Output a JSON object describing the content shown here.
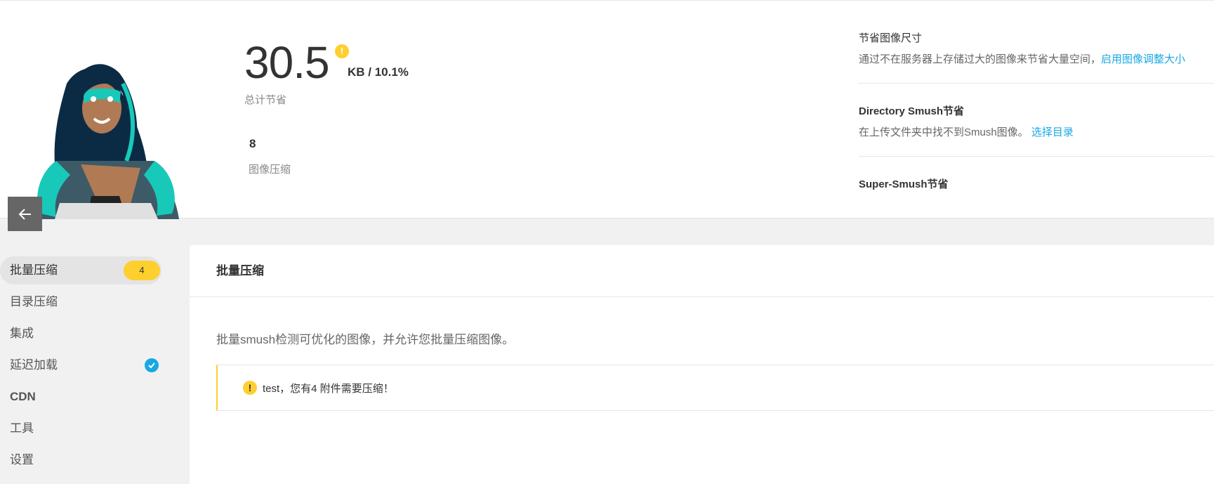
{
  "summary": {
    "total_savings_value": "30.5",
    "total_savings_unit": "KB / 10.1%",
    "total_savings_label": "总计节省",
    "images_count": "8",
    "images_label": "图像压缩",
    "resize": {
      "title": "节省图像尺寸",
      "desc": "通过不在服务器上存储过大的图像来节省大量空间，",
      "link": "启用图像调整大小"
    },
    "directory": {
      "title": "Directory Smush节省",
      "desc": "在上传文件夹中找不到Smush图像。",
      "link": "选择目录"
    },
    "super": {
      "title": "Super-Smush节省"
    }
  },
  "sidebar": {
    "items": [
      {
        "label": "批量压缩",
        "badge": "4"
      },
      {
        "label": "目录压缩"
      },
      {
        "label": "集成"
      },
      {
        "label": "延迟加载"
      },
      {
        "label": "CDN"
      },
      {
        "label": "工具"
      },
      {
        "label": "设置"
      }
    ]
  },
  "panel": {
    "title": "批量压缩",
    "description": "批量smush检测可优化的图像，并允许您批量压缩图像。",
    "notice": "test，您有4 附件需要压缩！"
  },
  "colors": {
    "accent_yellow": "#fecf2f",
    "link_blue": "#17a8e3"
  }
}
